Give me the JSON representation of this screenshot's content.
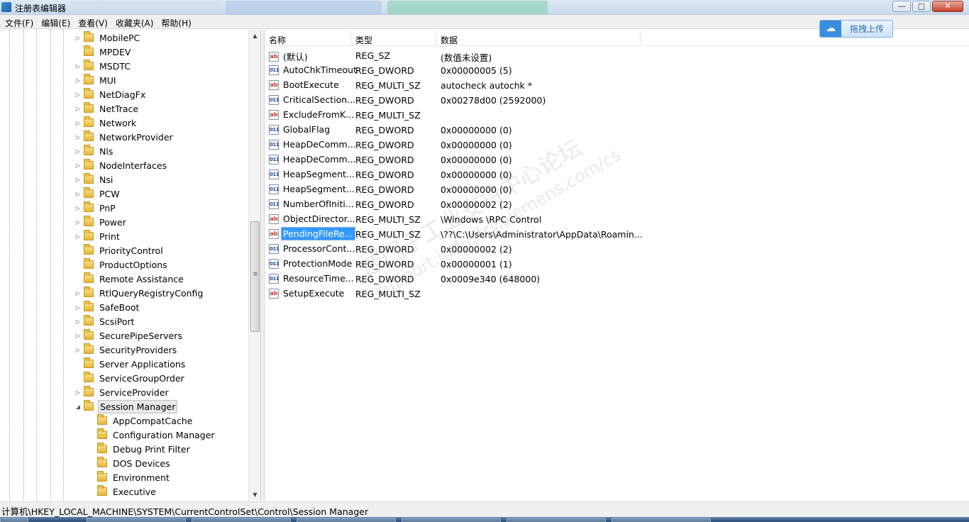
{
  "window": {
    "title": "注册表编辑器",
    "controls": {
      "minimize": "—",
      "maximize": "□",
      "close": "✕"
    }
  },
  "menu": [
    "文件(F)",
    "编辑(E)",
    "查看(V)",
    "收藏夹(A)",
    "帮助(H)"
  ],
  "upload_button": {
    "icon": "cloud-upload-icon",
    "label": "拖拽上传"
  },
  "tree": {
    "items": [
      {
        "label": "MobilePC",
        "expandable": true,
        "level": 0
      },
      {
        "label": "MPDEV",
        "expandable": false,
        "level": 0
      },
      {
        "label": "MSDTC",
        "expandable": true,
        "level": 0
      },
      {
        "label": "MUI",
        "expandable": true,
        "level": 0
      },
      {
        "label": "NetDiagFx",
        "expandable": true,
        "level": 0
      },
      {
        "label": "NetTrace",
        "expandable": true,
        "level": 0
      },
      {
        "label": "Network",
        "expandable": true,
        "level": 0
      },
      {
        "label": "NetworkProvider",
        "expandable": true,
        "level": 0
      },
      {
        "label": "Nls",
        "expandable": true,
        "level": 0
      },
      {
        "label": "NodeInterfaces",
        "expandable": true,
        "level": 0
      },
      {
        "label": "Nsi",
        "expandable": true,
        "level": 0
      },
      {
        "label": "PCW",
        "expandable": true,
        "level": 0
      },
      {
        "label": "PnP",
        "expandable": true,
        "level": 0
      },
      {
        "label": "Power",
        "expandable": true,
        "level": 0
      },
      {
        "label": "Print",
        "expandable": true,
        "level": 0
      },
      {
        "label": "PriorityControl",
        "expandable": false,
        "level": 0
      },
      {
        "label": "ProductOptions",
        "expandable": false,
        "level": 0
      },
      {
        "label": "Remote Assistance",
        "expandable": false,
        "level": 0
      },
      {
        "label": "RtlQueryRegistryConfig",
        "expandable": true,
        "level": 0
      },
      {
        "label": "SafeBoot",
        "expandable": true,
        "level": 0
      },
      {
        "label": "ScsiPort",
        "expandable": true,
        "level": 0
      },
      {
        "label": "SecurePipeServers",
        "expandable": true,
        "level": 0
      },
      {
        "label": "SecurityProviders",
        "expandable": true,
        "level": 0
      },
      {
        "label": "Server Applications",
        "expandable": false,
        "level": 0
      },
      {
        "label": "ServiceGroupOrder",
        "expandable": false,
        "level": 0
      },
      {
        "label": "ServiceProvider",
        "expandable": true,
        "level": 0
      },
      {
        "label": "Session Manager",
        "expandable": true,
        "expanded": true,
        "selected": true,
        "level": 0
      },
      {
        "label": "AppCompatCache",
        "expandable": false,
        "level": 1
      },
      {
        "label": "Configuration Manager",
        "expandable": false,
        "level": 1
      },
      {
        "label": "Debug Print Filter",
        "expandable": false,
        "level": 1
      },
      {
        "label": "DOS Devices",
        "expandable": false,
        "level": 1
      },
      {
        "label": "Environment",
        "expandable": false,
        "level": 1
      },
      {
        "label": "Executive",
        "expandable": false,
        "level": 1
      }
    ]
  },
  "list": {
    "columns": [
      "名称",
      "类型",
      "数据"
    ],
    "rows": [
      {
        "name": "(默认)",
        "type": "REG_SZ",
        "data": "(数值未设置)",
        "icon": "string-value-icon"
      },
      {
        "name": "AutoChkTimeout",
        "type": "REG_DWORD",
        "data": "0x00000005 (5)",
        "icon": "binary-value-icon"
      },
      {
        "name": "BootExecute",
        "type": "REG_MULTI_SZ",
        "data": "autocheck autochk *",
        "icon": "string-value-icon"
      },
      {
        "name": "CriticalSection...",
        "type": "REG_DWORD",
        "data": "0x00278d00 (2592000)",
        "icon": "binary-value-icon"
      },
      {
        "name": "ExcludeFromK...",
        "type": "REG_MULTI_SZ",
        "data": "",
        "icon": "string-value-icon"
      },
      {
        "name": "GlobalFlag",
        "type": "REG_DWORD",
        "data": "0x00000000 (0)",
        "icon": "binary-value-icon"
      },
      {
        "name": "HeapDeComm...",
        "type": "REG_DWORD",
        "data": "0x00000000 (0)",
        "icon": "binary-value-icon"
      },
      {
        "name": "HeapDeComm...",
        "type": "REG_DWORD",
        "data": "0x00000000 (0)",
        "icon": "binary-value-icon"
      },
      {
        "name": "HeapSegment...",
        "type": "REG_DWORD",
        "data": "0x00000000 (0)",
        "icon": "binary-value-icon"
      },
      {
        "name": "HeapSegment...",
        "type": "REG_DWORD",
        "data": "0x00000000 (0)",
        "icon": "binary-value-icon"
      },
      {
        "name": "NumberOfIniti...",
        "type": "REG_DWORD",
        "data": "0x00000002 (2)",
        "icon": "binary-value-icon"
      },
      {
        "name": "ObjectDirector...",
        "type": "REG_MULTI_SZ",
        "data": "\\Windows \\RPC Control",
        "icon": "string-value-icon"
      },
      {
        "name": "PendingFileRe...",
        "type": "REG_MULTI_SZ",
        "data": "\\??\\C:\\Users\\Administrator\\AppData\\Roamin...",
        "icon": "string-value-icon",
        "selected": true
      },
      {
        "name": "ProcessorCont...",
        "type": "REG_DWORD",
        "data": "0x00000002 (2)",
        "icon": "binary-value-icon"
      },
      {
        "name": "ProtectionMode",
        "type": "REG_DWORD",
        "data": "0x00000001 (1)",
        "icon": "binary-value-icon"
      },
      {
        "name": "ResourceTime...",
        "type": "REG_DWORD",
        "data": "0x0009e340 (648000)",
        "icon": "binary-value-icon"
      },
      {
        "name": "SetupExecute",
        "type": "REG_MULTI_SZ",
        "data": "",
        "icon": "string-value-icon"
      }
    ]
  },
  "watermark": {
    "line1": "西门子工业支持中心论坛",
    "line2": "support.industry.siemens.com/cs"
  },
  "status": {
    "path": "计算机\\HKEY_LOCAL_MACHINE\\SYSTEM\\CurrentControlSet\\Control\\Session Manager"
  }
}
